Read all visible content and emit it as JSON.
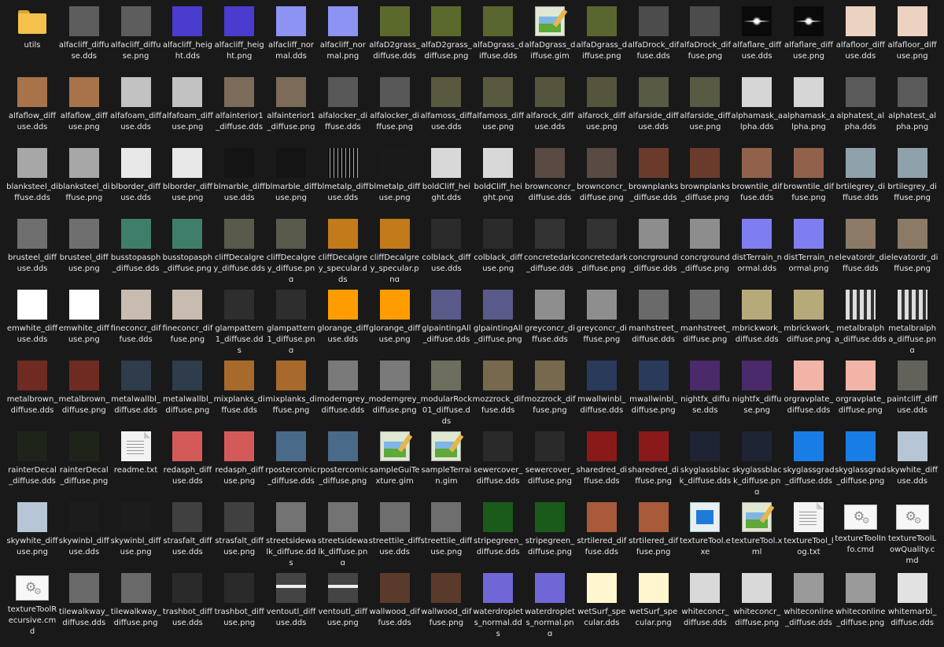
{
  "items": [
    {
      "label": "utils",
      "kind": "folder",
      "color": "#f4c24b"
    },
    {
      "label": "alfacliff_diffuse.dds",
      "kind": "tex",
      "color": "#5d5d5d"
    },
    {
      "label": "alfacliff_diffuse.png",
      "kind": "tex",
      "color": "#5d5d5d"
    },
    {
      "label": "alfacliff_height.dds",
      "kind": "tex",
      "color": "#4a3ccf"
    },
    {
      "label": "alfacliff_height.png",
      "kind": "tex",
      "color": "#4a3ccf"
    },
    {
      "label": "alfacliff_normal.dds",
      "kind": "tex",
      "color": "#8c93f3"
    },
    {
      "label": "alfacliff_normal.png",
      "kind": "tex",
      "color": "#8c93f3"
    },
    {
      "label": "alfaD2grass_diffuse.dds",
      "kind": "tex",
      "color": "#5b6a2c"
    },
    {
      "label": "alfaD2grass_diffuse.png",
      "kind": "tex",
      "color": "#5b6a2c"
    },
    {
      "label": "alfaDgrass_diffuse.dds",
      "kind": "tex",
      "color": "#5a6630"
    },
    {
      "label": "alfaDgrass_diffuse.gim",
      "kind": "gimp",
      "color": "#dfe8d2"
    },
    {
      "label": "alfaDgrass_diffuse.png",
      "kind": "tex",
      "color": "#5a6630"
    },
    {
      "label": "alfaDrock_diffuse.dds",
      "kind": "tex",
      "color": "#4c4c4c"
    },
    {
      "label": "alfaDrock_diffuse.png",
      "kind": "tex",
      "color": "#4c4c4c"
    },
    {
      "label": "alfaflare_diffuse.dds",
      "kind": "flare",
      "color": "#0a0a0a"
    },
    {
      "label": "alfaflare_diffuse.png",
      "kind": "flare",
      "color": "#0a0a0a"
    },
    {
      "label": "alfafloor_diffuse.dds",
      "kind": "tex",
      "color": "#ecd2c0"
    },
    {
      "label": "alfafloor_diffuse.png",
      "kind": "tex",
      "color": "#ecd2c0"
    },
    {
      "label": "alfaflow_diffuse.dds",
      "kind": "tex",
      "color": "#a8734a"
    },
    {
      "label": "alfaflow_diffuse.png",
      "kind": "tex",
      "color": "#a8734a"
    },
    {
      "label": "alfafoam_diffuse.dds",
      "kind": "tex",
      "color": "#c2c2c2"
    },
    {
      "label": "alfafoam_diffuse.png",
      "kind": "tex",
      "color": "#c2c2c2"
    },
    {
      "label": "alfainterior1_diffuse.dds",
      "kind": "tex",
      "color": "#7d6b5a"
    },
    {
      "label": "alfainterior1_diffuse.png",
      "kind": "tex",
      "color": "#7d6b5a"
    },
    {
      "label": "alfalocker_diffuse.dds",
      "kind": "tex",
      "color": "#585858"
    },
    {
      "label": "alfalocker_diffuse.png",
      "kind": "tex",
      "color": "#585858"
    },
    {
      "label": "alfamoss_diffuse.dds",
      "kind": "tex",
      "color": "#59593f"
    },
    {
      "label": "alfamoss_diffuse.png",
      "kind": "tex",
      "color": "#59593f"
    },
    {
      "label": "alfarock_diffuse.dds",
      "kind": "tex",
      "color": "#55553e"
    },
    {
      "label": "alfarock_diffuse.png",
      "kind": "tex",
      "color": "#55553e"
    },
    {
      "label": "alfarside_diffuse.dds",
      "kind": "tex",
      "color": "#585a44"
    },
    {
      "label": "alfarside_diffuse.png",
      "kind": "tex",
      "color": "#585a44"
    },
    {
      "label": "alphamask_alpha.dds",
      "kind": "tex",
      "color": "#d6d6d6"
    },
    {
      "label": "alphamask_alpha.png",
      "kind": "tex",
      "color": "#d6d6d6"
    },
    {
      "label": "alphatest_alpha.dds",
      "kind": "tex",
      "color": "#5a5a5a"
    },
    {
      "label": "alphatest_alpha.png",
      "kind": "tex",
      "color": "#5a5a5a"
    },
    {
      "label": "blanksteel_diffuse.dds",
      "kind": "tex",
      "color": "#a7a7a7"
    },
    {
      "label": "blanksteel_diffuse.png",
      "kind": "tex",
      "color": "#a7a7a7"
    },
    {
      "label": "blborder_diffuse.dds",
      "kind": "tex",
      "color": "#e8e8e8"
    },
    {
      "label": "blborder_diffuse.png",
      "kind": "tex",
      "color": "#e8e8e8"
    },
    {
      "label": "blmarble_diffuse.dds",
      "kind": "tex",
      "color": "#141414"
    },
    {
      "label": "blmarble_diffuse.png",
      "kind": "tex",
      "color": "#141414"
    },
    {
      "label": "blmetalp_diffuse.dds",
      "kind": "barcode",
      "color": "#111111"
    },
    {
      "label": "blmetalp_diffuse.png",
      "kind": "tex",
      "color": "#1a1a1a"
    },
    {
      "label": "boldCliff_height.dds",
      "kind": "tex",
      "color": "#d8d8d8"
    },
    {
      "label": "boldCliff_height.png",
      "kind": "tex",
      "color": "#d8d8d8"
    },
    {
      "label": "brownconcr_diffuse.dds",
      "kind": "tex",
      "color": "#5a4a44"
    },
    {
      "label": "brownconcr_diffuse.png",
      "kind": "tex",
      "color": "#5a4a44"
    },
    {
      "label": "brownplanks_diffuse.dds",
      "kind": "tex",
      "color": "#6a3b2b"
    },
    {
      "label": "brownplanks_diffuse.png",
      "kind": "tex",
      "color": "#6a3b2b"
    },
    {
      "label": "browntile_diffuse.dds",
      "kind": "tex",
      "color": "#92614b"
    },
    {
      "label": "browntile_diffuse.png",
      "kind": "tex",
      "color": "#92614b"
    },
    {
      "label": "brtilegrey_diffuse.dds",
      "kind": "tex",
      "color": "#8fa2ab"
    },
    {
      "label": "brtilegrey_diffuse.png",
      "kind": "tex",
      "color": "#8fa2ab"
    },
    {
      "label": "brusteel_diffuse.dds",
      "kind": "tex",
      "color": "#6f6f6f"
    },
    {
      "label": "brusteel_diffuse.png",
      "kind": "tex",
      "color": "#6f6f6f"
    },
    {
      "label": "busstopasph_diffuse.dds",
      "kind": "tex",
      "color": "#3f7e6a"
    },
    {
      "label": "busstopasph_diffuse.png",
      "kind": "tex",
      "color": "#3f7e6a"
    },
    {
      "label": "cliffDecalgrey_diffuse.dds",
      "kind": "tex",
      "color": "#5a5a4c"
    },
    {
      "label": "cliffDecalgrey_diffuse.png",
      "kind": "tex",
      "color": "#5a5a4c"
    },
    {
      "label": "cliffDecalgrey_specular.dds",
      "kind": "tex",
      "color": "#c37a1a"
    },
    {
      "label": "cliffDecalgrey_specular.png",
      "kind": "tex",
      "color": "#c37a1a"
    },
    {
      "label": "colblack_diffuse.dds",
      "kind": "tex",
      "color": "#2b2b2b"
    },
    {
      "label": "colblack_diffuse.png",
      "kind": "tex",
      "color": "#2b2b2b"
    },
    {
      "label": "concretedark_diffuse.dds",
      "kind": "tex",
      "color": "#333333"
    },
    {
      "label": "concretedark_diffuse.png",
      "kind": "tex",
      "color": "#333333"
    },
    {
      "label": "concrground_diffuse.dds",
      "kind": "tex",
      "color": "#8d8d8d"
    },
    {
      "label": "concrground_diffuse.png",
      "kind": "tex",
      "color": "#8d8d8d"
    },
    {
      "label": "distTerrain_normal.dds",
      "kind": "tex",
      "color": "#7e7ef0"
    },
    {
      "label": "distTerrain_normal.png",
      "kind": "tex",
      "color": "#7e7ef0"
    },
    {
      "label": "elevatordr_diffuse.dds",
      "kind": "tex",
      "color": "#8a7a66"
    },
    {
      "label": "elevatordr_diffuse.png",
      "kind": "tex",
      "color": "#8a7a66"
    },
    {
      "label": "emwhite_diffuse.dds",
      "kind": "tex",
      "color": "#ffffff"
    },
    {
      "label": "emwhite_diffuse.png",
      "kind": "tex",
      "color": "#ffffff"
    },
    {
      "label": "fineconcr_diffuse.dds",
      "kind": "tex",
      "color": "#c8bcb0"
    },
    {
      "label": "fineconcr_diffuse.png",
      "kind": "tex",
      "color": "#c8bcb0"
    },
    {
      "label": "glampattern1_diffuse.dds",
      "kind": "tex",
      "color": "#2e2e2e"
    },
    {
      "label": "glampattern1_diffuse.png",
      "kind": "tex",
      "color": "#2e2e2e"
    },
    {
      "label": "glorange_diffuse.dds",
      "kind": "tex",
      "color": "#ff9d00"
    },
    {
      "label": "glorange_diffuse.png",
      "kind": "tex",
      "color": "#ff9d00"
    },
    {
      "label": "glpaintingAll_diffuse.dds",
      "kind": "tex",
      "color": "#5a5a8a"
    },
    {
      "label": "glpaintingAll_diffuse.png",
      "kind": "tex",
      "color": "#5a5a8a"
    },
    {
      "label": "greyconcr_diffuse.dds",
      "kind": "tex",
      "color": "#8e8e8e"
    },
    {
      "label": "greyconcr_diffuse.png",
      "kind": "tex",
      "color": "#8e8e8e"
    },
    {
      "label": "manhstreet_diffuse.dds",
      "kind": "tex",
      "color": "#6a6a6a"
    },
    {
      "label": "manhstreet_diffuse.png",
      "kind": "tex",
      "color": "#6a6a6a"
    },
    {
      "label": "mbrickwork_diffuse.dds",
      "kind": "tex",
      "color": "#b7aa7a"
    },
    {
      "label": "mbrickwork_diffuse.png",
      "kind": "tex",
      "color": "#b7aa7a"
    },
    {
      "label": "metalbralpha_diffuse.dds",
      "kind": "stripes",
      "color": "#999999"
    },
    {
      "label": "metalbralpha_diffuse.png",
      "kind": "stripes",
      "color": "#999999"
    },
    {
      "label": "metalbrown_diffuse.dds",
      "kind": "tex",
      "color": "#6f2a22"
    },
    {
      "label": "metalbrown_diffuse.png",
      "kind": "tex",
      "color": "#6f2a22"
    },
    {
      "label": "metalwallbl_diffuse.dds",
      "kind": "tex",
      "color": "#2e3c4c"
    },
    {
      "label": "metalwallbl_diffuse.png",
      "kind": "tex",
      "color": "#2e3c4c"
    },
    {
      "label": "mixplanks_diffuse.dds",
      "kind": "tex",
      "color": "#a86a2c"
    },
    {
      "label": "mixplanks_diffuse.png",
      "kind": "tex",
      "color": "#a86a2c"
    },
    {
      "label": "moderngrey_diffuse.dds",
      "kind": "tex",
      "color": "#7a7a7a"
    },
    {
      "label": "moderngrey_diffuse.png",
      "kind": "tex",
      "color": "#7a7a7a"
    },
    {
      "label": "modularRock01_diffuse.dds",
      "kind": "tex",
      "color": "#6e6e5e"
    },
    {
      "label": "mozzrock_diffuse.dds",
      "kind": "tex",
      "color": "#77694d"
    },
    {
      "label": "mozzrock_diffuse.png",
      "kind": "tex",
      "color": "#77694d"
    },
    {
      "label": "mwallwinbl_diffuse.dds",
      "kind": "tex",
      "color": "#2a3a5a"
    },
    {
      "label": "mwallwinbl_diffuse.png",
      "kind": "tex",
      "color": "#2a3a5a"
    },
    {
      "label": "nightfx_diffuse.dds",
      "kind": "tex",
      "color": "#4a2a6a"
    },
    {
      "label": "nightfx_diffuse.png",
      "kind": "tex",
      "color": "#4a2a6a"
    },
    {
      "label": "orgravplate_diffuse.dds",
      "kind": "tex",
      "color": "#f1b5a8"
    },
    {
      "label": "orgravplate_diffuse.png",
      "kind": "tex",
      "color": "#f1b5a8"
    },
    {
      "label": "paintcliff_diffuse.dds",
      "kind": "tex",
      "color": "#62625a"
    },
    {
      "label": "rainterDecal_diffuse.dds",
      "kind": "tex",
      "color": "#1f241a"
    },
    {
      "label": "rainterDecal_diffuse.png",
      "kind": "tex",
      "color": "#1f241a"
    },
    {
      "label": "readme.txt",
      "kind": "doc",
      "color": "#f3f3f3"
    },
    {
      "label": "redasph_diffuse.dds",
      "kind": "tex",
      "color": "#d45a5a"
    },
    {
      "label": "redasph_diffuse.png",
      "kind": "tex",
      "color": "#d45a5a"
    },
    {
      "label": "rpostercomic_diffuse.dds",
      "kind": "tex",
      "color": "#4a6a8a"
    },
    {
      "label": "rpostercomic_diffuse.png",
      "kind": "tex",
      "color": "#4a6a8a"
    },
    {
      "label": "sampleGuiTexture.gim",
      "kind": "gimp",
      "color": "#dfe8d2"
    },
    {
      "label": "sampleTerrain.gim",
      "kind": "gimp",
      "color": "#dfe8d2"
    },
    {
      "label": "sewercover_diffuse.dds",
      "kind": "tex",
      "color": "#2a2a2a"
    },
    {
      "label": "sewercover_diffuse.png",
      "kind": "tex",
      "color": "#2a2a2a"
    },
    {
      "label": "sharedred_diffuse.dds",
      "kind": "tex",
      "color": "#8a1a1a"
    },
    {
      "label": "sharedred_diffuse.png",
      "kind": "tex",
      "color": "#8a1a1a"
    },
    {
      "label": "skyglassblack_diffuse.dds",
      "kind": "tex",
      "color": "#1e2433"
    },
    {
      "label": "skyglassblack_diffuse.png",
      "kind": "tex",
      "color": "#1e2433"
    },
    {
      "label": "skyglassgrad_diffuse.dds",
      "kind": "tex",
      "color": "#1a7de6"
    },
    {
      "label": "skyglassgrad_diffuse.png",
      "kind": "tex",
      "color": "#1a7de6"
    },
    {
      "label": "skywhite_diffuse.dds",
      "kind": "tex",
      "color": "#b6c6d6"
    },
    {
      "label": "skywhite_diffuse.png",
      "kind": "tex",
      "color": "#b6c6d6"
    },
    {
      "label": "skywinbl_diffuse.dds",
      "kind": "tex",
      "color": "#1c1c1c"
    },
    {
      "label": "skywinbl_diffuse.png",
      "kind": "tex",
      "color": "#1c1c1c"
    },
    {
      "label": "strasfalt_diffuse.dds",
      "kind": "tex",
      "color": "#404040"
    },
    {
      "label": "strasfalt_diffuse.png",
      "kind": "tex",
      "color": "#404040"
    },
    {
      "label": "streetsidewalk_diffuse.dds",
      "kind": "tex",
      "color": "#737373"
    },
    {
      "label": "streetsidewalk_diffuse.png",
      "kind": "tex",
      "color": "#737373"
    },
    {
      "label": "streettile_diffuse.dds",
      "kind": "tex",
      "color": "#6e6e6e"
    },
    {
      "label": "streettile_diffuse.png",
      "kind": "tex",
      "color": "#6e6e6e"
    },
    {
      "label": "stripegreen_diffuse.dds",
      "kind": "tex",
      "color": "#1a5a1a"
    },
    {
      "label": "stripegreen_diffuse.png",
      "kind": "tex",
      "color": "#1a5a1a"
    },
    {
      "label": "strtilered_diffuse.dds",
      "kind": "tex",
      "color": "#a85a3a"
    },
    {
      "label": "strtilered_diffuse.png",
      "kind": "tex",
      "color": "#a85a3a"
    },
    {
      "label": "textureTool.exe",
      "kind": "exe",
      "color": "#1e7bd8"
    },
    {
      "label": "textureTool.xml",
      "kind": "gimp",
      "color": "#dfe8d2"
    },
    {
      "label": "textureTool_log.txt",
      "kind": "doc",
      "color": "#f3f3f3"
    },
    {
      "label": "textureToolInfo.cmd",
      "kind": "cmd",
      "color": "#f7f7f7"
    },
    {
      "label": "textureToolLowQuality.cmd",
      "kind": "cmd",
      "color": "#f7f7f7"
    },
    {
      "label": "textureToolRecursive.cmd",
      "kind": "cmd",
      "color": "#f7f7f7"
    },
    {
      "label": "tilewalkway_diffuse.dds",
      "kind": "tex",
      "color": "#6a6a6a"
    },
    {
      "label": "tilewalkway_diffuse.png",
      "kind": "tex",
      "color": "#6a6a6a"
    },
    {
      "label": "trashbot_diffuse.dds",
      "kind": "tex",
      "color": "#2a2a2a"
    },
    {
      "label": "trashbot_diffuse.png",
      "kind": "tex",
      "color": "#2a2a2a"
    },
    {
      "label": "ventoutl_diffuse.dds",
      "kind": "bands",
      "color": "#444444"
    },
    {
      "label": "ventoutl_diffuse.png",
      "kind": "bands",
      "color": "#444444"
    },
    {
      "label": "wallwood_diffuse.dds",
      "kind": "tex",
      "color": "#5a3a2a"
    },
    {
      "label": "wallwood_diffuse.png",
      "kind": "tex",
      "color": "#5a3a2a"
    },
    {
      "label": "waterdroplets_normal.dds",
      "kind": "tex",
      "color": "#6f67d6"
    },
    {
      "label": "waterdroplets_normal.png",
      "kind": "tex",
      "color": "#6f67d6"
    },
    {
      "label": "wetSurf_specular.dds",
      "kind": "tex",
      "color": "#fff6cf"
    },
    {
      "label": "wetSurf_specular.png",
      "kind": "tex",
      "color": "#fff6cf"
    },
    {
      "label": "whiteconcr_diffuse.dds",
      "kind": "tex",
      "color": "#d9d9d9"
    },
    {
      "label": "whiteconcr_diffuse.png",
      "kind": "tex",
      "color": "#d9d9d9"
    },
    {
      "label": "whiteconline_diffuse.dds",
      "kind": "tex",
      "color": "#9a9a9a"
    },
    {
      "label": "whiteconline_diffuse.png",
      "kind": "tex",
      "color": "#9a9a9a"
    },
    {
      "label": "whitemarbl_diffuse.dds",
      "kind": "tex",
      "color": "#e2e2e2"
    }
  ]
}
